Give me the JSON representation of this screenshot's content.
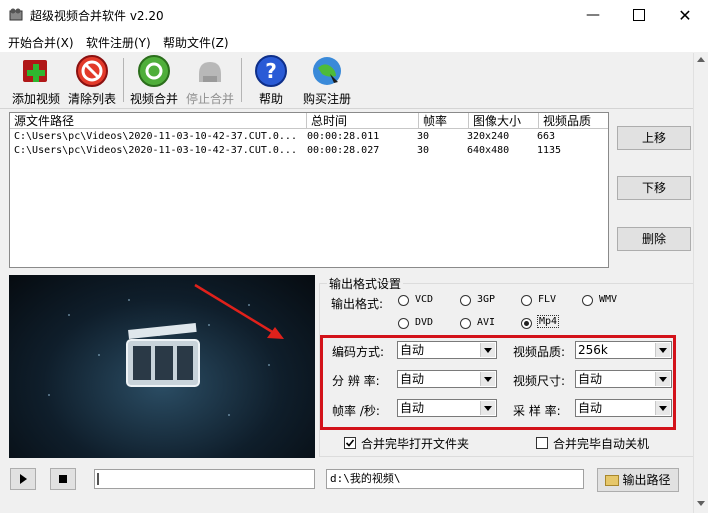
{
  "window": {
    "title": "超级视频合并软件 v2.20"
  },
  "menu": [
    "开始合并(X)",
    "软件注册(Y)",
    "帮助文件(Z)"
  ],
  "toolbar": {
    "add_video": "添加视频",
    "clear_list": "清除列表",
    "merge_video": "视频合并",
    "stop_merge": "停止合并",
    "help": "帮助",
    "buy_register": "购买注册"
  },
  "list": {
    "headers": [
      "源文件路径",
      "总时间",
      "帧率",
      "图像大小",
      "视频品质"
    ],
    "rows": [
      {
        "path": "C:\\Users\\pc\\Videos\\2020-11-03-10-42-37.CUT.0...",
        "time": "00:00:28.011",
        "fps": "30",
        "size": "320x240",
        "quality": "663"
      },
      {
        "path": "C:\\Users\\pc\\Videos\\2020-11-03-10-42-37.CUT.0...",
        "time": "00:00:28.027",
        "fps": "30",
        "size": "640x480",
        "quality": "1135"
      }
    ]
  },
  "side_buttons": {
    "move_up": "上移",
    "move_down": "下移",
    "delete": "删除"
  },
  "output": {
    "group_title": "输出格式设置",
    "format_label": "输出格式:",
    "formats": [
      "VCD",
      "3GP",
      "FLV",
      "WMV",
      "DVD",
      "AVI",
      "Mp4"
    ],
    "selected_format": "Mp4",
    "encoding_label": "编码方式:",
    "encoding_value": "自动",
    "quality_label": "视频品质:",
    "quality_value": "256k",
    "resolution_label": "分 辨 率:",
    "resolution_value": "自动",
    "video_size_label": "视频尺寸:",
    "video_size_value": "自动",
    "fps_label": "帧率 /秒:",
    "fps_value": "自动",
    "sample_label": "采 样 率:",
    "sample_value": "自动",
    "open_folder_label": "合并完毕打开文件夹",
    "open_folder_checked": true,
    "shutdown_label": "合并完毕自动关机",
    "shutdown_checked": false,
    "path_value": "d:\\我的视频\\",
    "output_path_button": "输出路径"
  },
  "colors": {
    "highlight_border": "#d3121a"
  }
}
